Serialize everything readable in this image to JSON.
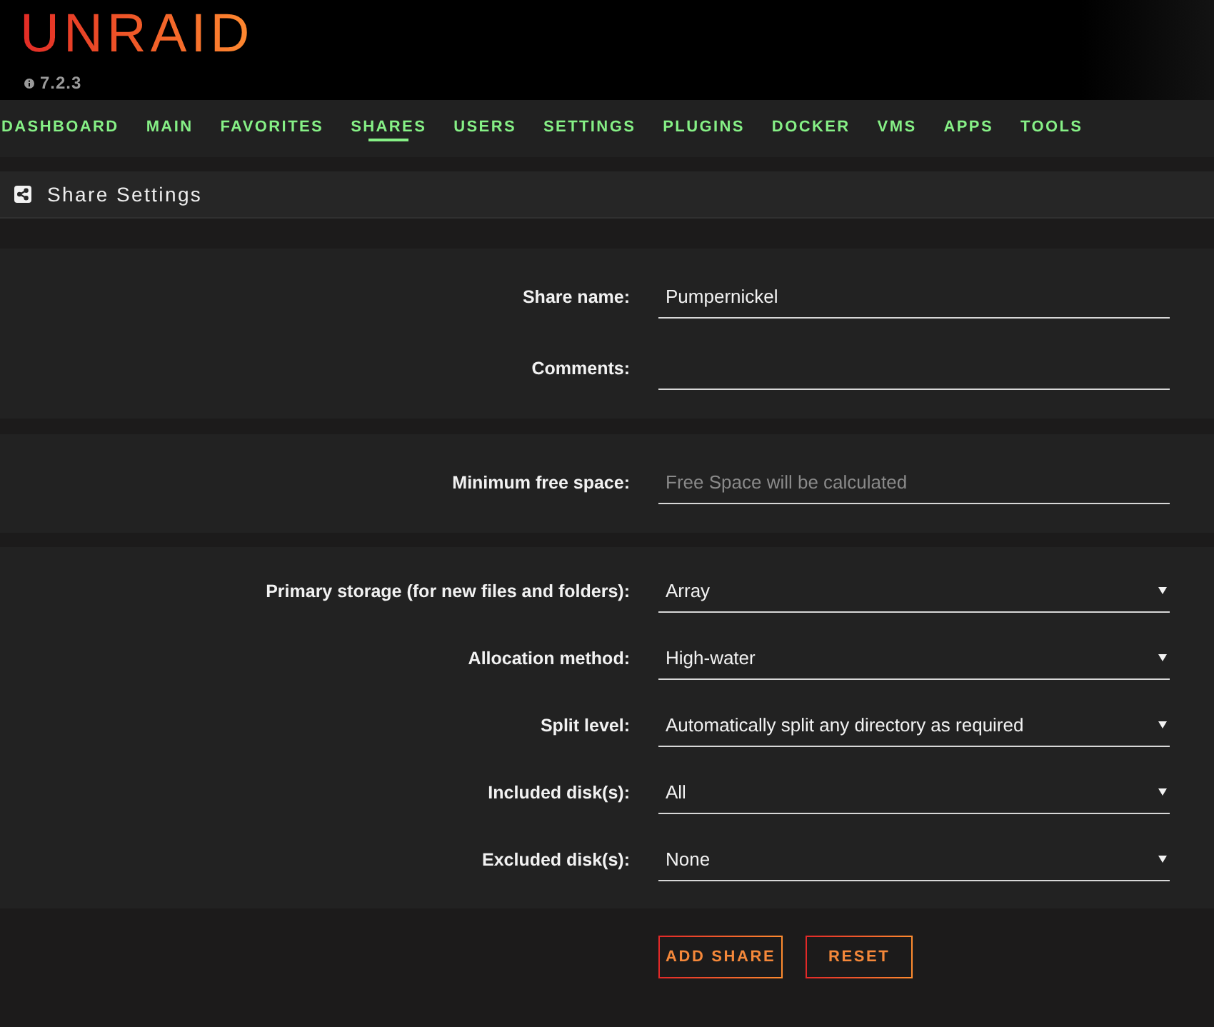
{
  "header": {
    "logo": "UNRAID",
    "version": "7.2.3"
  },
  "nav": [
    {
      "label": "DASHBOARD",
      "selected": false
    },
    {
      "label": "MAIN",
      "selected": false
    },
    {
      "label": "FAVORITES",
      "selected": false
    },
    {
      "label": "SHARES",
      "selected": true
    },
    {
      "label": "USERS",
      "selected": false
    },
    {
      "label": "SETTINGS",
      "selected": false
    },
    {
      "label": "PLUGINS",
      "selected": false
    },
    {
      "label": "DOCKER",
      "selected": false
    },
    {
      "label": "VMS",
      "selected": false
    },
    {
      "label": "APPS",
      "selected": false
    },
    {
      "label": "TOOLS",
      "selected": false
    }
  ],
  "section": {
    "title": "Share Settings"
  },
  "panels": [
    {
      "fields": [
        {
          "kind": "text",
          "label": "Share name:",
          "value": "Pumpernickel"
        },
        {
          "kind": "text",
          "label": "Comments:"
        }
      ]
    },
    {
      "fields": [
        {
          "kind": "text",
          "label": "Minimum free space:",
          "placeholder": "Free Space will be calculated"
        }
      ]
    },
    {
      "fields": [
        {
          "kind": "select",
          "label": "Primary storage (for new files and folders):",
          "value": "Array"
        },
        {
          "kind": "select",
          "label": "Allocation method:",
          "value": "High-water"
        },
        {
          "kind": "select",
          "label": "Split level:",
          "value": "Automatically split any directory as required"
        },
        {
          "kind": "select",
          "label": "Included disk(s):",
          "value": "All"
        },
        {
          "kind": "select",
          "label": "Excluded disk(s):",
          "value": "None"
        }
      ]
    }
  ],
  "buttons": [
    "ADD SHARE",
    "RESET"
  ]
}
